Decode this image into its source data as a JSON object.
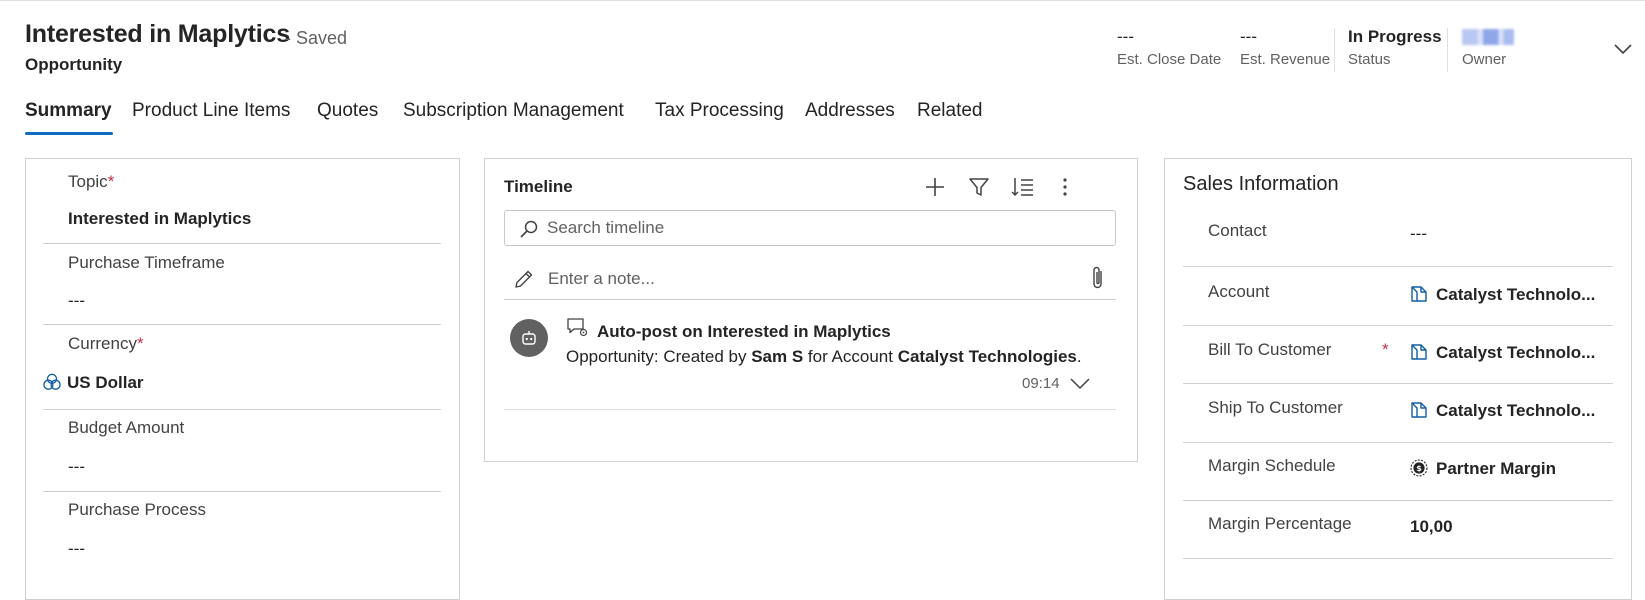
{
  "header": {
    "title": "Interested in Maplytics",
    "saved_status": "- Saved",
    "entity": "Opportunity",
    "fields": [
      {
        "value": "---",
        "label": "Est. Close Date"
      },
      {
        "value": "---",
        "label": "Est. Revenue"
      },
      {
        "value": "In Progress",
        "label": "Status"
      },
      {
        "value": "",
        "label": "Owner"
      }
    ]
  },
  "tabs": [
    {
      "label": "Summary",
      "active": true
    },
    {
      "label": "Product Line Items"
    },
    {
      "label": "Quotes"
    },
    {
      "label": "Subscription Management"
    },
    {
      "label": "Tax Processing"
    },
    {
      "label": "Addresses"
    },
    {
      "label": "Related"
    }
  ],
  "summary_fields": {
    "topic": {
      "label": "Topic",
      "required_mark": "*",
      "value": "Interested in Maplytics"
    },
    "purchase_timeframe": {
      "label": "Purchase Timeframe",
      "value": "---"
    },
    "currency": {
      "label": "Currency",
      "required_mark": "*",
      "value": "US Dollar"
    },
    "budget_amount": {
      "label": "Budget Amount",
      "value": "---"
    },
    "purchase_process": {
      "label": "Purchase Process",
      "value": "---"
    }
  },
  "timeline": {
    "title": "Timeline",
    "search_placeholder": "Search timeline",
    "note_placeholder": "Enter a note...",
    "posts": [
      {
        "title": "Auto-post on Interested in Maplytics",
        "body_prefix": "Opportunity: Created by ",
        "body_user": "Sam S",
        "body_mid": " for Account ",
        "body_account": "Catalyst Technologies",
        "body_suffix": ".",
        "time": "09:14"
      }
    ]
  },
  "sales_information": {
    "title": "Sales Information",
    "fields": [
      {
        "label": "Contact",
        "value": "---"
      },
      {
        "label": "Account",
        "value": "Catalyst Technolo..."
      },
      {
        "label": "Bill To Customer",
        "required_mark": "*",
        "value": "Catalyst Technolo..."
      },
      {
        "label": "Ship To Customer",
        "value": "Catalyst Technolo..."
      },
      {
        "label": "Margin Schedule",
        "value": "Partner Margin"
      },
      {
        "label": "Margin Percentage",
        "value": "10,00"
      }
    ]
  },
  "colors": {
    "accent": "#0f6cbd",
    "link": "#115ea3",
    "required": "#c4314b"
  }
}
